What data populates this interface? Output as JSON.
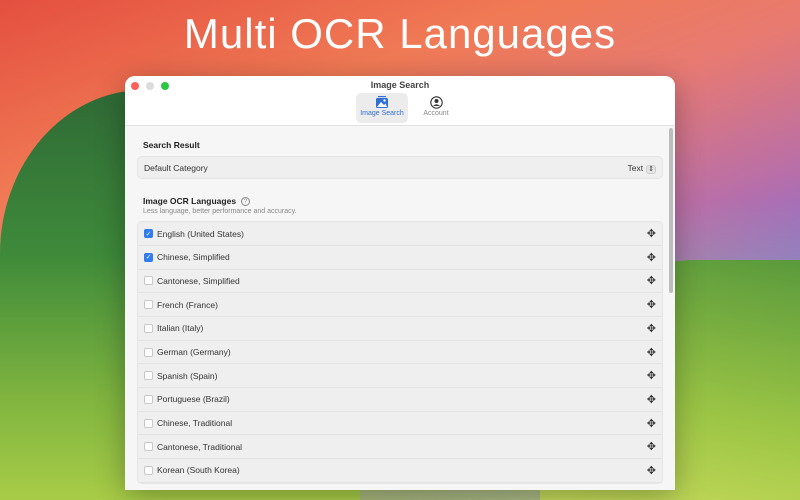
{
  "headline": "Multi OCR Languages",
  "window": {
    "title": "Image Search",
    "tabs": [
      {
        "label": "Image Search",
        "icon": "photo-stack-icon",
        "active": true
      },
      {
        "label": "Account",
        "icon": "person-circle-icon",
        "active": false
      }
    ]
  },
  "search_result": {
    "heading": "Search Result",
    "default_category_label": "Default Category",
    "default_category_value": "Text"
  },
  "ocr": {
    "heading": "Image OCR Languages",
    "subtitle": "Less language, better performance and accuracy.",
    "languages": [
      {
        "name": "English (United States)",
        "checked": true
      },
      {
        "name": "Chinese, Simplified",
        "checked": true
      },
      {
        "name": "Cantonese, Simplified",
        "checked": false
      },
      {
        "name": "French (France)",
        "checked": false
      },
      {
        "name": "Italian (Italy)",
        "checked": false
      },
      {
        "name": "German (Germany)",
        "checked": false
      },
      {
        "name": "Spanish (Spain)",
        "checked": false
      },
      {
        "name": "Portuguese (Brazil)",
        "checked": false
      },
      {
        "name": "Chinese, Traditional",
        "checked": false
      },
      {
        "name": "Cantonese, Traditional",
        "checked": false
      },
      {
        "name": "Korean (South Korea)",
        "checked": false
      }
    ]
  },
  "colors": {
    "accent": "#2f7bf0"
  }
}
